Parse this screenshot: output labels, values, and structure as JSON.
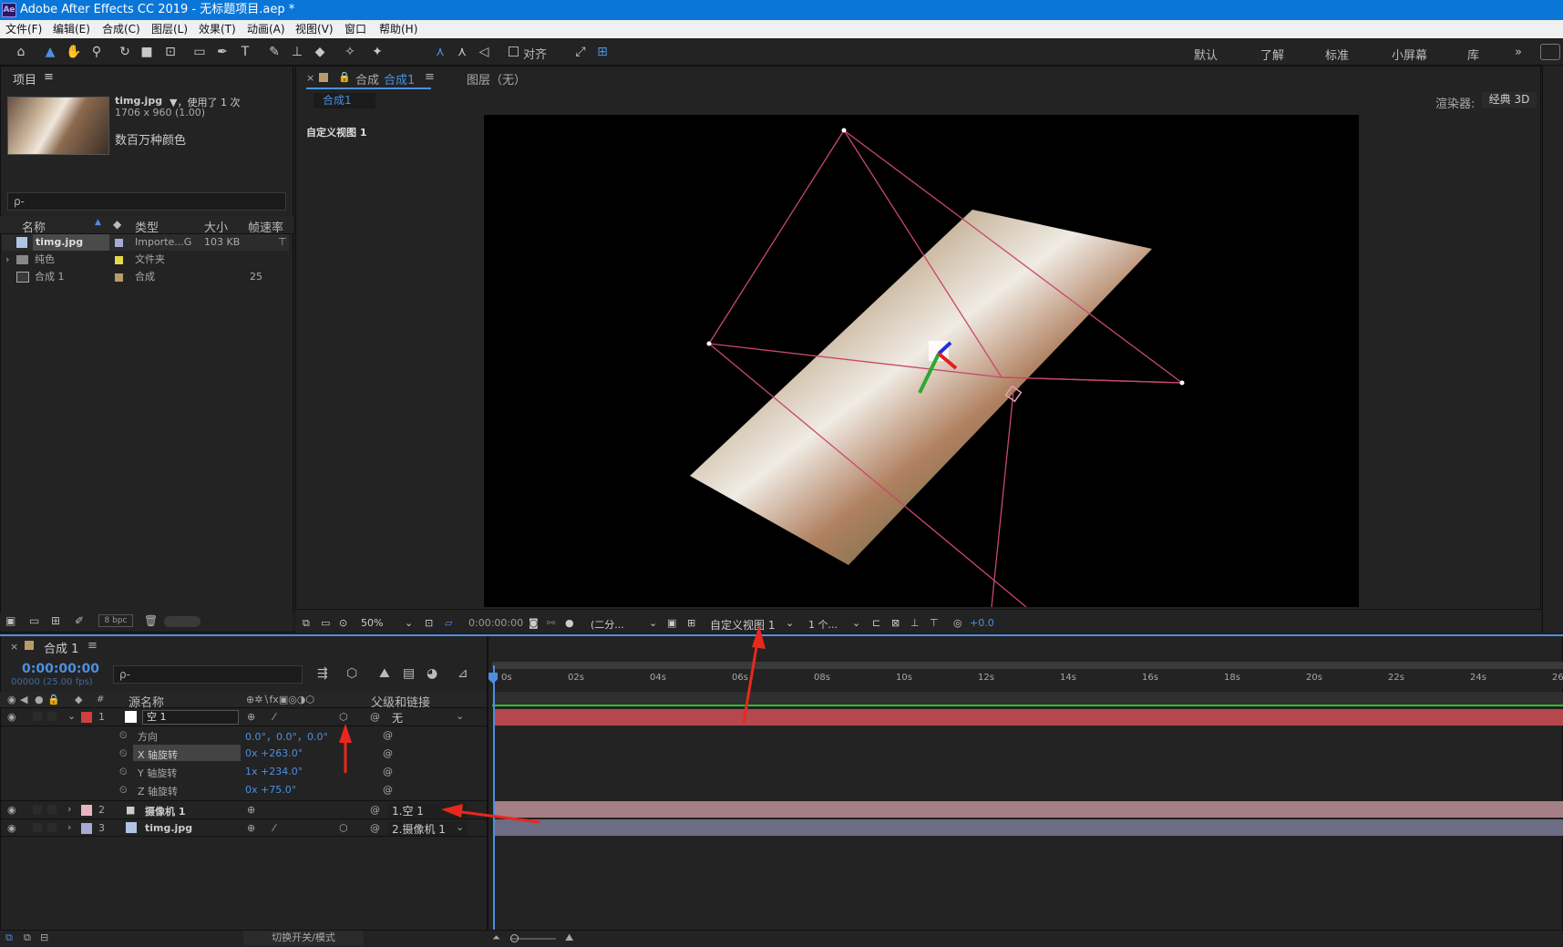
{
  "window": {
    "title": "Adobe After Effects CC 2019 - 无标题项目.aep *",
    "logo": "Ae"
  },
  "menu": [
    "文件(F)",
    "编辑(E)",
    "合成(C)",
    "图层(L)",
    "效果(T)",
    "动画(A)",
    "视图(V)",
    "窗口",
    "帮助(H)"
  ],
  "toolbar": {
    "align_label": "对齐",
    "workspaces": [
      "默认",
      "了解",
      "标准",
      "小屏幕",
      "库"
    ],
    "more": "»"
  },
  "project": {
    "title": "项目",
    "menu_icon": "≡",
    "asset_name": "timg.jpg",
    "asset_usage": "▼，使用了 1 次",
    "asset_dims": "1706 x 960 (1.00)",
    "asset_colors": "数百万种颜色",
    "search_placeholder": "ρ-",
    "columns": [
      "名称",
      "类型",
      "大小",
      "帧速率"
    ],
    "items": [
      {
        "name": "timg.jpg",
        "type": "Importe...G",
        "size": "103 KB",
        "fps": "",
        "color": "#a9a9d6"
      },
      {
        "name": "纯色",
        "type": "文件夹",
        "size": "",
        "fps": "",
        "color": "#e4d84c"
      },
      {
        "name": "合成 1",
        "type": "合成",
        "size": "",
        "fps": "25",
        "color": "#b99b6b"
      }
    ],
    "bpc": "8 bpc"
  },
  "comp": {
    "tab_close": "×",
    "tab_label": "合成",
    "tab_active": "合成1",
    "layer_tab": "图层（无）",
    "breadcrumb": "合成1",
    "renderer_label": "渲染器:",
    "renderer_value": "经典 3D",
    "view_label": "自定义视图 1",
    "zoom": "50%",
    "timecode": "0:00:00:00",
    "resolution": "(二分...",
    "view_select": "自定义视图 1",
    "views_count": "1 个...",
    "exposure": "+0.0"
  },
  "timeline": {
    "tab": "合成 1",
    "timecode": "0:00:00:00",
    "fps_info": "00000 (25.00 fps)",
    "search_placeholder": "ρ-",
    "col_source": "源名称",
    "col_parent": "父级和链接",
    "col_num": "#",
    "ticks": [
      "0s",
      "02s",
      "04s",
      "06s",
      "08s",
      "10s",
      "12s",
      "14s",
      "16s",
      "18s",
      "20s",
      "22s",
      "24s",
      "26"
    ],
    "layers": [
      {
        "num": "1",
        "name": "空 1",
        "parent": "无",
        "color": "#d13f3f"
      },
      {
        "num": "2",
        "name": "摄像机 1",
        "parent": "1.空 1",
        "color": "#e7b6c2"
      },
      {
        "num": "3",
        "name": "timg.jpg",
        "parent": "2.摄像机 1",
        "color": "#a9a9d6"
      }
    ],
    "props": [
      {
        "name": "方向",
        "value": "0.0°，0.0°，0.0°"
      },
      {
        "name": "X 轴旋转",
        "value": "0x +263.0°"
      },
      {
        "name": "Y 轴旋转",
        "value": "1x +234.0°"
      },
      {
        "name": "Z 轴旋转",
        "value": "0x +75.0°"
      }
    ],
    "footer": "切换开关/模式"
  }
}
